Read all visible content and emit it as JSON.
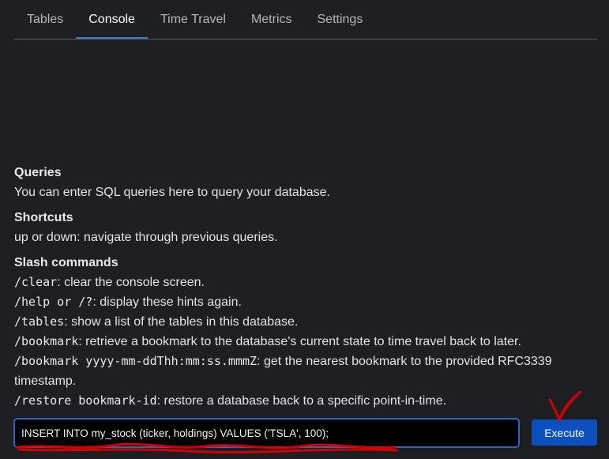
{
  "tabs": [
    {
      "label": "Tables"
    },
    {
      "label": "Console"
    },
    {
      "label": "Time Travel"
    },
    {
      "label": "Metrics"
    },
    {
      "label": "Settings"
    }
  ],
  "active_tab": "Console",
  "hints": {
    "queries_title": "Queries",
    "queries_text": "You can enter SQL queries here to query your database.",
    "shortcuts_title": "Shortcuts",
    "shortcuts_text": "up or down: navigate through previous queries.",
    "slash_title": "Slash commands",
    "commands": [
      {
        "cmd": "/clear",
        "desc": ": clear the console screen."
      },
      {
        "cmd": "/help or /?",
        "desc": ": display these hints again."
      },
      {
        "cmd": "/tables",
        "desc": ": show a list of the tables in this database."
      },
      {
        "cmd": "/bookmark",
        "desc": ": retrieve a bookmark to the database's current state to time travel back to later."
      },
      {
        "cmd": "/bookmark yyyy-mm-ddThh:mm:ss.mmmZ",
        "desc": ": get the nearest bookmark to the provided RFC3339 timestamp."
      },
      {
        "cmd": "/restore bookmark-id",
        "desc": ": restore a database back to a specific point-in-time."
      }
    ]
  },
  "console": {
    "input_value": "INSERT INTO my_stock (ticker, holdings) VALUES ('TSLA', 100);",
    "execute_label": "Execute"
  },
  "colors": {
    "background": "#1d1f23",
    "accent": "#2d63c8",
    "button": "#0b4fc1",
    "annotation": "#d40000"
  },
  "annotations": {
    "underline": "red scribble underline",
    "checkmark": "red checkmark-icon"
  }
}
